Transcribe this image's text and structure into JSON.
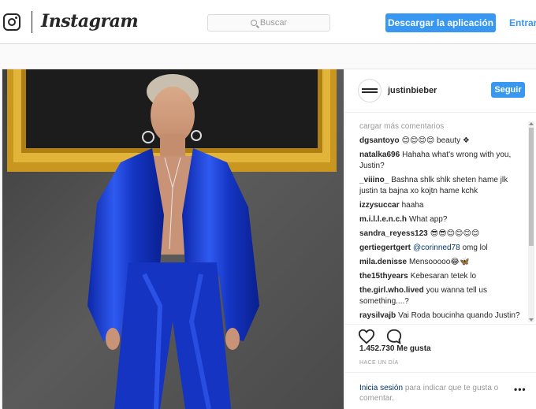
{
  "header": {
    "wordmark": "Instagram",
    "search_placeholder": "Buscar",
    "download_label": "Descargar la aplicación",
    "login_label": "Entrar"
  },
  "post": {
    "username": "justinbieber",
    "follow_label": "Seguir",
    "load_more": "cargar más comentarios",
    "comments": [
      {
        "user": "dgsantoyo",
        "text": "😊😊😊😊 beauty ❖"
      },
      {
        "user": "natalka696",
        "text": "Hahaha what's wrong with you, Justin?"
      },
      {
        "user": "_viiino_",
        "text": "Bashna shlk shlk sheten hame jlk justin ta bajna xo kojtn hame kchk"
      },
      {
        "user": "izzysuccar",
        "text": "haaha"
      },
      {
        "user": "m.i.l.l.e.n.c.h",
        "text": "What app?"
      },
      {
        "user": "sandra_reyess123",
        "text": "😎😎😊😊😊😊"
      },
      {
        "user": "gertiegertgert",
        "mention": "@corinned78",
        "text": "omg lol"
      },
      {
        "user": "mila.denisse",
        "text": "Mensooooo😂🦋"
      },
      {
        "user": "the15thyears",
        "text": "Kebesaran tetek lo"
      },
      {
        "user": "the.girl.who.lived",
        "text": "you wanna tell us something....?"
      },
      {
        "user": "raysilvajb",
        "text": "Vai Roda boucinha quando Justin? Kkkkk 😉 ce não faz noção do"
      }
    ],
    "likes": "1.452.730 Me gusta",
    "time": "HACE UN DÍA",
    "login_prompt_link": "Inicia sesión",
    "login_prompt_rest": "para indicar que te gusta o comentar.",
    "more_label": "•••"
  },
  "icons": {
    "like": "heart-icon",
    "comment": "comment-icon",
    "logo": "instagram-camera-icon",
    "search": "search-icon"
  },
  "colors": {
    "accent": "#3897f0",
    "outfit": "#1a3fd6",
    "frame": "#d4a52a"
  }
}
